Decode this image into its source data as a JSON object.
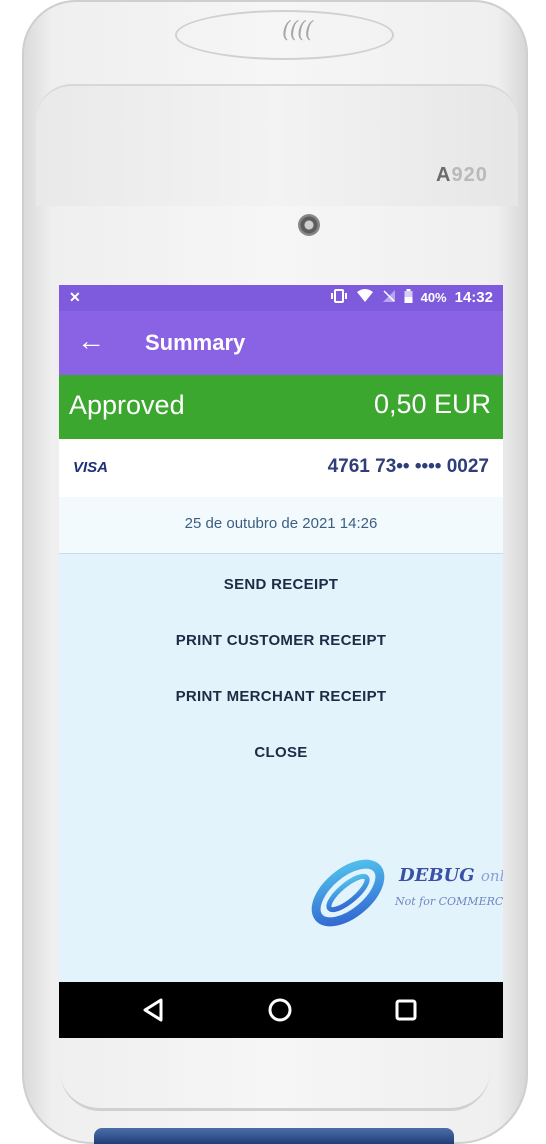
{
  "device": {
    "model_prefix": "A",
    "model_number": "920"
  },
  "status_bar": {
    "left_icon": "notification-icon",
    "battery": "40%",
    "time": "14:32"
  },
  "app_bar": {
    "back_icon": "arrow-left-icon",
    "title": "Summary"
  },
  "result": {
    "status": "Approved",
    "amount": "0,50 EUR",
    "color": "#3ba72e"
  },
  "card": {
    "brand": "VISA",
    "number": "4761 73•• •••• 0027"
  },
  "transaction": {
    "datetime": "25 de outubro de 2021 14:26"
  },
  "actions": {
    "send_receipt": "SEND RECEIPT",
    "print_customer_receipt": "PRINT CUSTOMER RECEIPT",
    "print_merchant_receipt": "PRINT MERCHANT RECEIPT",
    "close": "CLOSE"
  },
  "watermark": {
    "title": "DEBUG",
    "title_suffix": "only",
    "subtitle": "Not for COMMERCIAL"
  },
  "nav_bar": {
    "back": "triangle-back-icon",
    "home": "circle-home-icon",
    "recents": "square-recents-icon"
  },
  "colors": {
    "status_bar": "#7d5bdc",
    "app_bar": "#8a63e4",
    "screen_bg": "#e3f3fb",
    "accent_green": "#3ba72e"
  }
}
